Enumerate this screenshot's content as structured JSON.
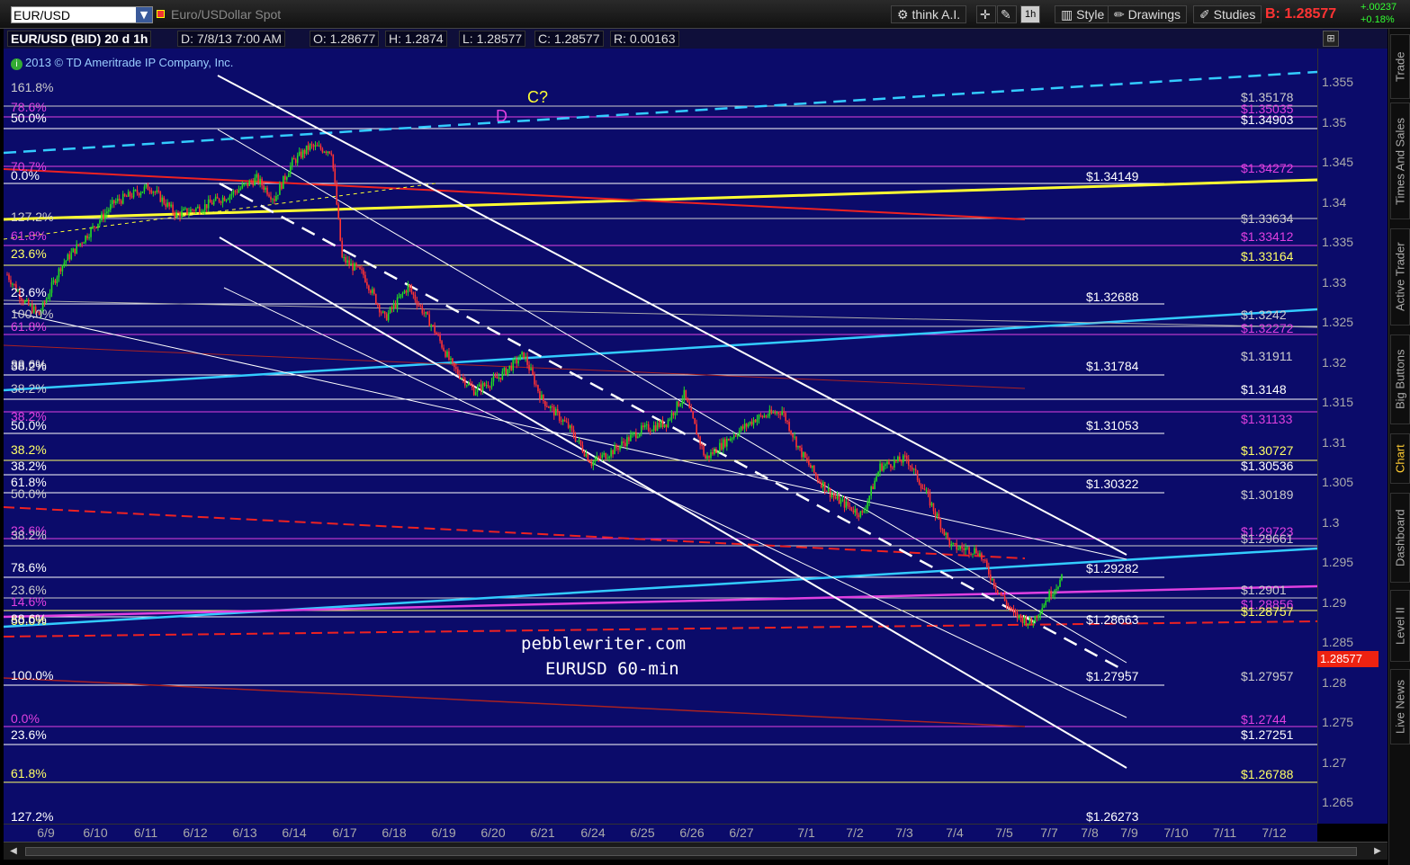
{
  "toolbar": {
    "symbol": "EUR/USD",
    "description": "Euro/USDollar Spot",
    "think_ai": "think A.I.",
    "timeframe": "1h",
    "style": "Style",
    "drawings": "Drawings",
    "studies": "Studies",
    "bid_label": "B: 1.28577",
    "change": "+.00237",
    "change_pct": "+0.18%"
  },
  "header": {
    "title": "EUR/USD (BID) 20 d 1h",
    "date": "D: 7/8/13 7:00 AM",
    "open": "O: 1.28677",
    "high": "H: 1.2874",
    "low": "L: 1.28577",
    "close": "C: 1.28577",
    "range": "R: 0.00163"
  },
  "copyright": "2013 © TD Ameritrade IP Company, Inc.",
  "annotations": {
    "watermark1": "pebblewriter.com",
    "watermark2": "EURUSD 60-min",
    "wave_c": "C?",
    "wave_d": "D"
  },
  "price_axis": [
    "1.355",
    "1.35",
    "1.345",
    "1.34",
    "1.335",
    "1.33",
    "1.325",
    "1.32",
    "1.315",
    "1.31",
    "1.305",
    "1.3",
    "1.295",
    "1.29",
    "1.285",
    "1.28",
    "1.275",
    "1.27",
    "1.265"
  ],
  "current_price": "1.28577",
  "date_axis": [
    "6/9",
    "6/10",
    "6/11",
    "6/12",
    "6/13",
    "6/14",
    "6/17",
    "6/18",
    "6/19",
    "6/20",
    "6/21",
    "6/24",
    "6/25",
    "6/26",
    "6/27",
    "7/1",
    "7/2",
    "7/3",
    "7/4",
    "7/5",
    "7/7",
    "7/8",
    "7/9",
    "7/10",
    "7/11",
    "7/12"
  ],
  "fib_labels_left": [
    {
      "text": "161.8%",
      "color": "#cccccc"
    },
    {
      "text": "78.6%",
      "color": "#e040e0"
    },
    {
      "text": "50.0%",
      "color": "#ffffff"
    },
    {
      "text": "70.7%",
      "color": "#e040e0"
    },
    {
      "text": "0.0%",
      "color": "#ffffff"
    },
    {
      "text": "127.2%",
      "color": "#cccccc"
    },
    {
      "text": "61.8%",
      "color": "#e040e0"
    },
    {
      "text": "23.6%",
      "color": "#ffff66"
    },
    {
      "text": "23.6%",
      "color": "#ffffff"
    },
    {
      "text": "100.0%",
      "color": "#cccccc"
    },
    {
      "text": "61.8%",
      "color": "#e040e0"
    },
    {
      "text": "88.6%",
      "color": "#cccccc"
    },
    {
      "text": "38.2%",
      "color": "#ffffff"
    },
    {
      "text": "38.2%",
      "color": "#cccccc"
    },
    {
      "text": "38.2%",
      "color": "#e040e0"
    },
    {
      "text": "50.0%",
      "color": "#ffffff"
    },
    {
      "text": "38.2%",
      "color": "#ffff66"
    },
    {
      "text": "38.2%",
      "color": "#ffffff"
    },
    {
      "text": "61.8%",
      "color": "#ffffff"
    },
    {
      "text": "50.0%",
      "color": "#cccccc"
    },
    {
      "text": "23.6%",
      "color": "#e040e0"
    },
    {
      "text": "38.2%",
      "color": "#cccccc"
    },
    {
      "text": "78.6%",
      "color": "#ffffff"
    },
    {
      "text": "23.6%",
      "color": "#cccccc"
    },
    {
      "text": "14.6%",
      "color": "#e040e0"
    },
    {
      "text": "50.0%",
      "color": "#ffff66"
    },
    {
      "text": "88.6%",
      "color": "#ffffff"
    },
    {
      "text": "100.0%",
      "color": "#ffffff"
    },
    {
      "text": "0.0%",
      "color": "#e040e0"
    },
    {
      "text": "23.6%",
      "color": "#ffffff"
    },
    {
      "text": "61.8%",
      "color": "#ffff66"
    },
    {
      "text": "127.2%",
      "color": "#ffffff"
    }
  ],
  "fib_values_mid": [
    "$1.34149",
    "$1.32688",
    "$1.31784",
    "$1.31053",
    "$1.30322",
    "$1.29282",
    "$1.28663",
    "$1.27957",
    "$1.26273"
  ],
  "fib_values_right": [
    {
      "text": "$1.35178",
      "color": "#cccccc"
    },
    {
      "text": "$1.35035",
      "color": "#e040e0"
    },
    {
      "text": "$1.34903",
      "color": "#ffffff"
    },
    {
      "text": "$1.34272",
      "color": "#e040e0"
    },
    {
      "text": "$1.33634",
      "color": "#cccccc"
    },
    {
      "text": "$1.33412",
      "color": "#e040e0"
    },
    {
      "text": "$1.33164",
      "color": "#ffff66"
    },
    {
      "text": "$1.3242",
      "color": "#cccccc"
    },
    {
      "text": "$1.32272",
      "color": "#e040e0"
    },
    {
      "text": "$1.31911",
      "color": "#cccccc"
    },
    {
      "text": "$1.3148",
      "color": "#ffffff"
    },
    {
      "text": "$1.31133",
      "color": "#e040e0"
    },
    {
      "text": "$1.30727",
      "color": "#ffff66"
    },
    {
      "text": "$1.30536",
      "color": "#ffffff"
    },
    {
      "text": "$1.30189",
      "color": "#cccccc"
    },
    {
      "text": "$1.29723",
      "color": "#e040e0"
    },
    {
      "text": "$1.29661",
      "color": "#cccccc"
    },
    {
      "text": "$1.2901",
      "color": "#cccccc"
    },
    {
      "text": "$1.28856",
      "color": "#e040e0"
    },
    {
      "text": "$1.28757",
      "color": "#ffff66"
    },
    {
      "text": "$1.27957",
      "color": "#cccccc"
    },
    {
      "text": "$1.2744",
      "color": "#e040e0"
    },
    {
      "text": "$1.27251",
      "color": "#ffffff"
    },
    {
      "text": "$1.26788",
      "color": "#ffff66"
    }
  ],
  "sidebar": [
    "Trade",
    "Times And Sales",
    "Active Trader",
    "Big Buttons",
    "Chart",
    "Dashboard",
    "Level II",
    "Live News"
  ],
  "colors": {
    "chart_bg": "#0b0b6a",
    "up": "#22dd22",
    "down": "#ff3333",
    "fib_white": "#ffffff",
    "fib_magenta": "#e040e0",
    "fib_yellow": "#ffff66",
    "trend_cyan": "#33ccff",
    "trend_yellow": "#ffff33"
  }
}
